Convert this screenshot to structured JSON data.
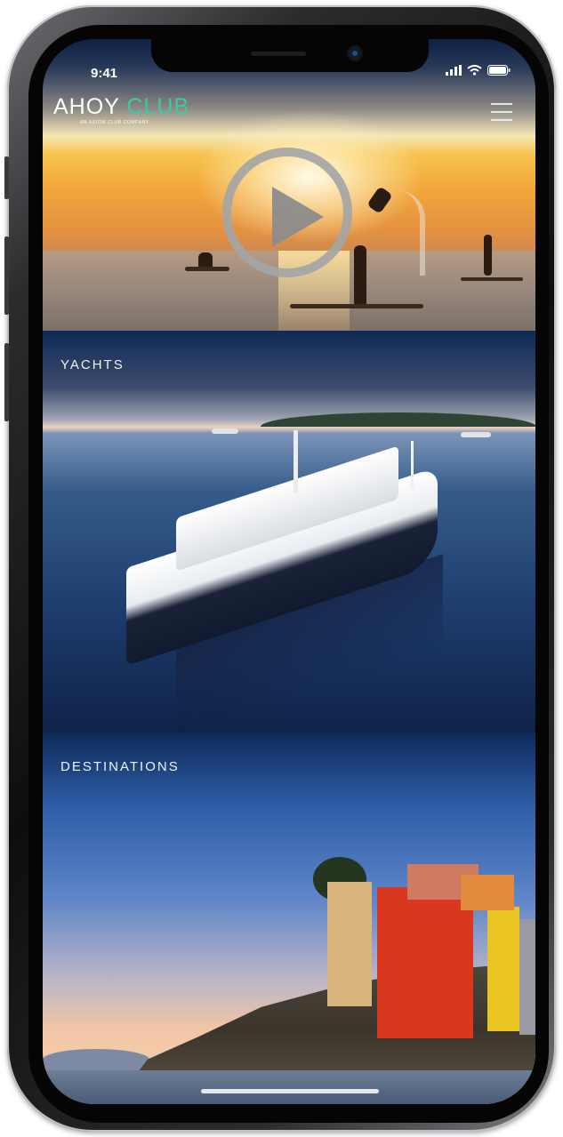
{
  "status_bar": {
    "time": "9:41"
  },
  "header": {
    "logo_primary": "AHOY",
    "logo_accent": "CLUB",
    "logo_tagline": "AN AXIOM CLUB COMPANY",
    "menu_icon": "hamburger-menu-icon"
  },
  "hero": {
    "play_icon": "play-icon"
  },
  "sections": {
    "yachts_label": "YACHTS",
    "destinations_label": "DESTINATIONS"
  },
  "colors": {
    "brand_accent": "#3fc8a4",
    "text_light": "#ffffff"
  }
}
